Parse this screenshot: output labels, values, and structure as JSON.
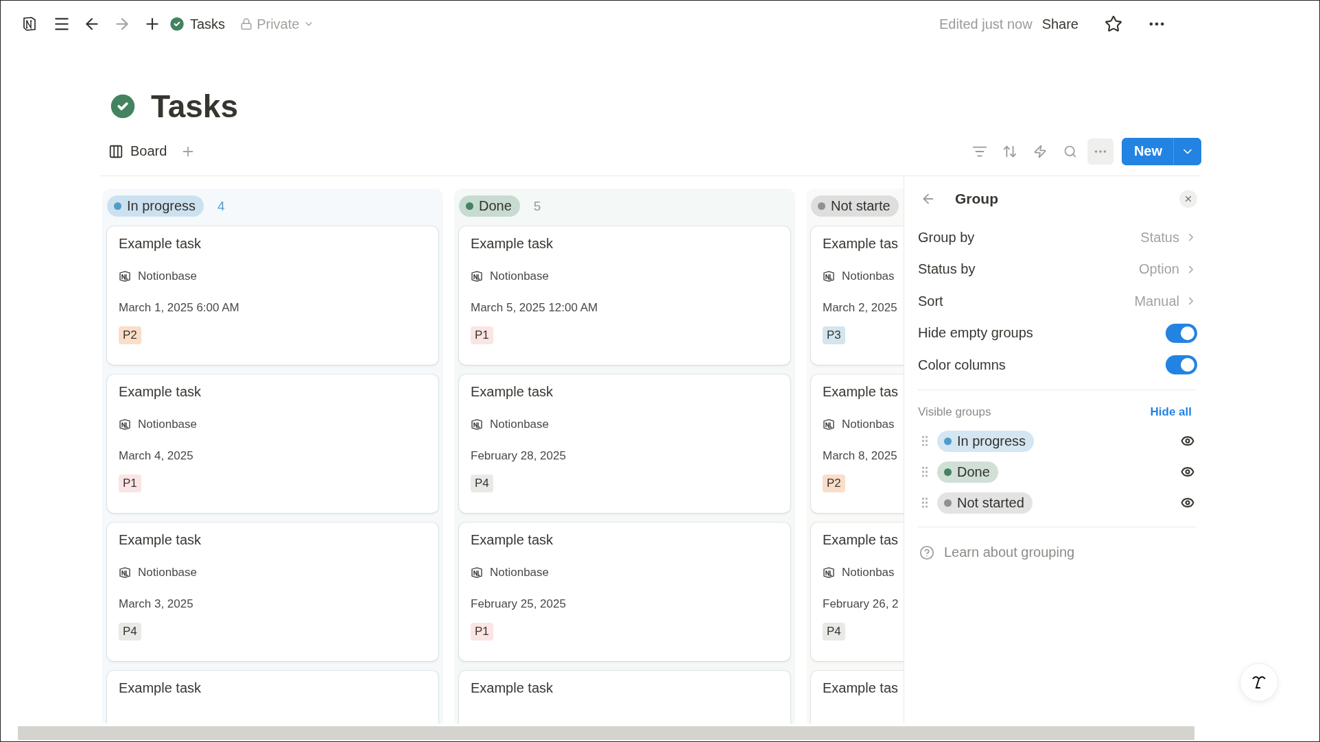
{
  "topbar": {
    "breadcrumb": "Tasks",
    "privacy": "Private",
    "edited": "Edited just now",
    "share": "Share"
  },
  "page": {
    "title": "Tasks"
  },
  "views": [
    {
      "label": "Board",
      "selected": true
    }
  ],
  "toolbar": {
    "new_button": "New"
  },
  "board": {
    "columns": [
      {
        "name": "In progress",
        "count": "4",
        "color": "#529cca",
        "cards": [
          {
            "title": "Example task",
            "source": "Notionbase",
            "date": "March 1, 2025 6:00 AM",
            "priority": {
              "label": "P2",
              "color": "#fadec9"
            }
          },
          {
            "title": "Example task",
            "source": "Notionbase",
            "date": "March 4, 2025",
            "priority": {
              "label": "P1",
              "color": "#fbe4e4"
            }
          },
          {
            "title": "Example task",
            "source": "Notionbase",
            "date": "March 3, 2025",
            "priority": {
              "label": "P4",
              "color": "#e9e9e7"
            }
          },
          {
            "title": "Example task"
          }
        ]
      },
      {
        "name": "Done",
        "count": "5",
        "color": "#448361",
        "cards": [
          {
            "title": "Example task",
            "source": "Notionbase",
            "date": "March 5, 2025 12:00 AM",
            "priority": {
              "label": "P1",
              "color": "#fbe4e4"
            }
          },
          {
            "title": "Example task",
            "source": "Notionbase",
            "date": "February 28, 2025",
            "priority": {
              "label": "P4",
              "color": "#e9e9e7"
            }
          },
          {
            "title": "Example task",
            "source": "Notionbase",
            "date": "February 25, 2025",
            "priority": {
              "label": "P1",
              "color": "#fbe4e4"
            }
          },
          {
            "title": "Example task"
          }
        ]
      },
      {
        "name": "Not starte",
        "color": "#91918e",
        "cards": [
          {
            "title": "Example tas",
            "source": "Notionbas",
            "date": "March 2, 2025",
            "priority": {
              "label": "P3",
              "color": "#d3e5ef"
            }
          },
          {
            "title": "Example tas",
            "source": "Notionbas",
            "date": "March 8, 2025",
            "priority": {
              "label": "P2",
              "color": "#fadec9"
            }
          },
          {
            "title": "Example tas",
            "source": "Notionbas",
            "date": "February 26, 2",
            "priority": {
              "label": "P4",
              "color": "#e9e9e7"
            }
          },
          {
            "title": "Example tas"
          }
        ]
      }
    ]
  },
  "panel": {
    "title": "Group",
    "settings": [
      {
        "kind": "select",
        "label": "Group by",
        "value": "Status"
      },
      {
        "kind": "select",
        "label": "Status by",
        "value": "Option"
      },
      {
        "kind": "select",
        "label": "Sort",
        "value": "Manual"
      },
      {
        "kind": "toggle",
        "label": "Hide empty groups",
        "on": true
      },
      {
        "kind": "toggle",
        "label": "Color columns",
        "on": true
      }
    ],
    "visible_groups": {
      "heading": "Visible groups",
      "action": "Hide all",
      "groups": [
        {
          "name": "In progress",
          "color": "#529cca",
          "visible": true
        },
        {
          "name": "Done",
          "color": "#448361",
          "visible": true
        },
        {
          "name": "Not started",
          "color": "#91918e",
          "visible": true
        }
      ]
    },
    "help": "Learn about grouping"
  }
}
